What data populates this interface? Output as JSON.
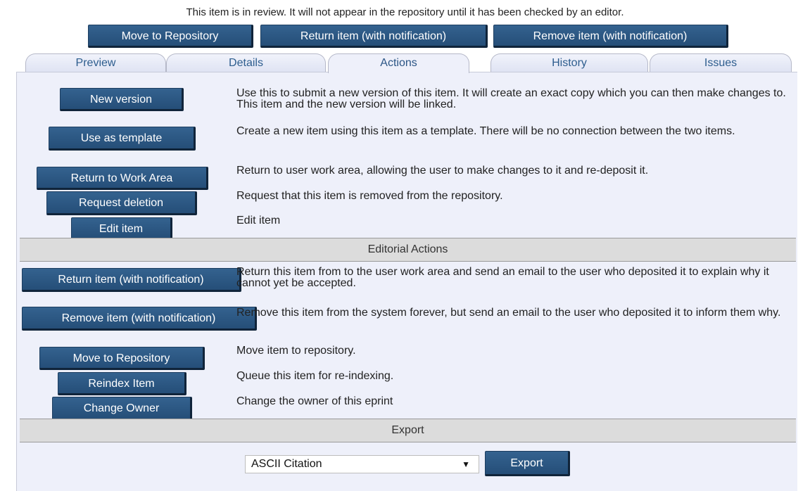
{
  "notice": "This item is in review. It will not appear in the repository until it has been checked by an editor.",
  "top_buttons": {
    "move": "Move to Repository",
    "return": "Return item (with notification)",
    "remove": "Remove item (with notification)"
  },
  "tabs": [
    "Preview",
    "Details",
    "Actions",
    "History",
    "Issues"
  ],
  "actions": [
    {
      "button": "New version",
      "desc": "Use this to submit a new version of this item. It will create an exact copy which you can then make changes to. This item and the new version will be linked."
    },
    {
      "button": "Use as template",
      "desc": "Create a new item using this item as a template. There will be no connection between the two items."
    },
    {
      "button": "Return to Work Area",
      "desc": "Return to user work area, allowing the user to make changes to it and re-deposit it."
    },
    {
      "button": "Request deletion",
      "desc": "Request that this item is removed from the repository."
    },
    {
      "button": "Edit item",
      "desc": "Edit item"
    }
  ],
  "editorial": {
    "title": "Editorial Actions",
    "items": [
      {
        "button": "Return item (with notification)",
        "desc": "Return this item from to the user work area and send an email to the user who deposited it to explain why it cannot yet be accepted."
      },
      {
        "button": "Remove item (with notification)",
        "desc": "Remove this item from the system forever, but send an email to the user who deposited it to inform them why."
      },
      {
        "button": "Move to Repository",
        "desc": "Move item to repository."
      },
      {
        "button": "Reindex Item",
        "desc": "Queue this item for re-indexing."
      },
      {
        "button": "Change Owner",
        "desc": "Change the owner of this eprint"
      }
    ]
  },
  "export": {
    "title": "Export",
    "selected": "ASCII Citation",
    "button": "Export"
  }
}
